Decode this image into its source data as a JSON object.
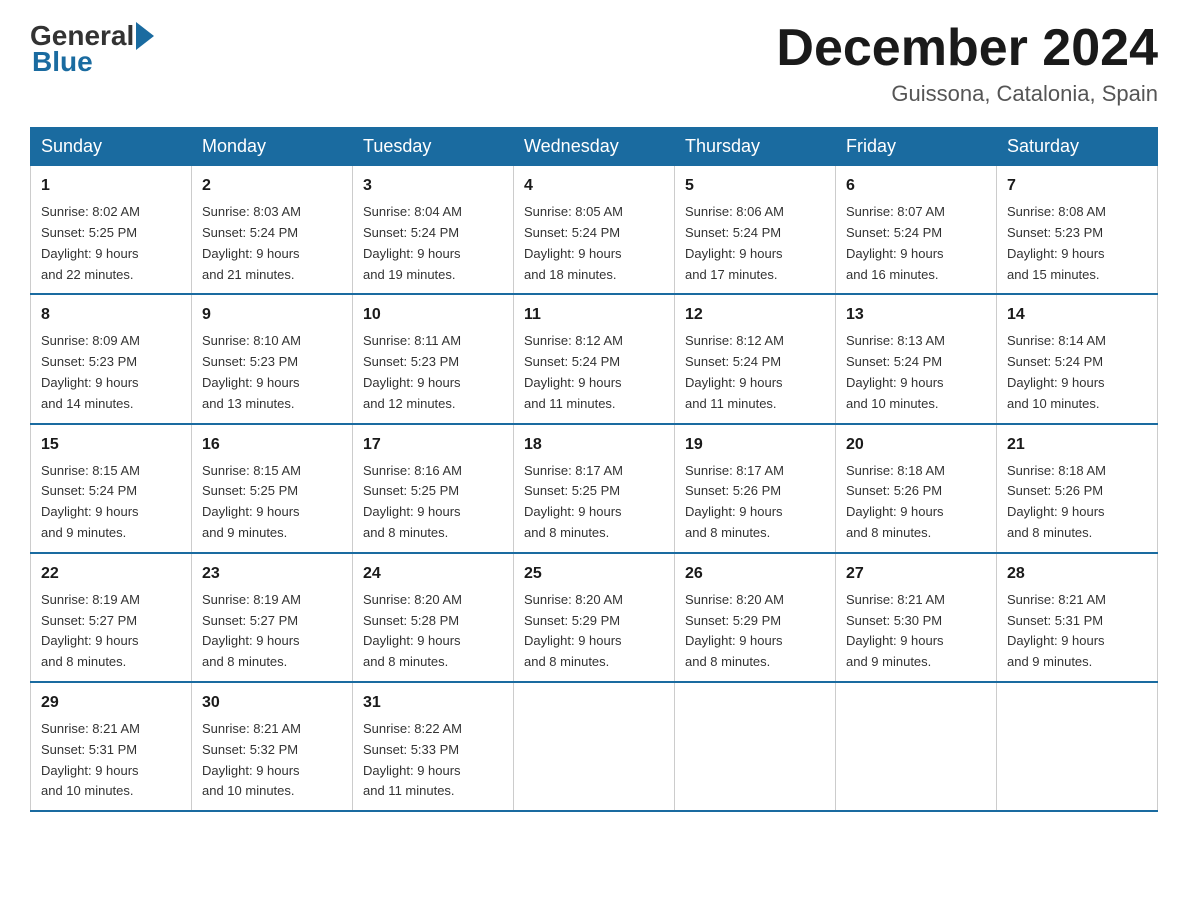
{
  "logo": {
    "general": "General",
    "blue": "Blue"
  },
  "title": "December 2024",
  "location": "Guissona, Catalonia, Spain",
  "headers": [
    "Sunday",
    "Monday",
    "Tuesday",
    "Wednesday",
    "Thursday",
    "Friday",
    "Saturday"
  ],
  "weeks": [
    [
      {
        "day": "1",
        "sunrise": "8:02 AM",
        "sunset": "5:25 PM",
        "daylight": "9 hours and 22 minutes."
      },
      {
        "day": "2",
        "sunrise": "8:03 AM",
        "sunset": "5:24 PM",
        "daylight": "9 hours and 21 minutes."
      },
      {
        "day": "3",
        "sunrise": "8:04 AM",
        "sunset": "5:24 PM",
        "daylight": "9 hours and 19 minutes."
      },
      {
        "day": "4",
        "sunrise": "8:05 AM",
        "sunset": "5:24 PM",
        "daylight": "9 hours and 18 minutes."
      },
      {
        "day": "5",
        "sunrise": "8:06 AM",
        "sunset": "5:24 PM",
        "daylight": "9 hours and 17 minutes."
      },
      {
        "day": "6",
        "sunrise": "8:07 AM",
        "sunset": "5:24 PM",
        "daylight": "9 hours and 16 minutes."
      },
      {
        "day": "7",
        "sunrise": "8:08 AM",
        "sunset": "5:23 PM",
        "daylight": "9 hours and 15 minutes."
      }
    ],
    [
      {
        "day": "8",
        "sunrise": "8:09 AM",
        "sunset": "5:23 PM",
        "daylight": "9 hours and 14 minutes."
      },
      {
        "day": "9",
        "sunrise": "8:10 AM",
        "sunset": "5:23 PM",
        "daylight": "9 hours and 13 minutes."
      },
      {
        "day": "10",
        "sunrise": "8:11 AM",
        "sunset": "5:23 PM",
        "daylight": "9 hours and 12 minutes."
      },
      {
        "day": "11",
        "sunrise": "8:12 AM",
        "sunset": "5:24 PM",
        "daylight": "9 hours and 11 minutes."
      },
      {
        "day": "12",
        "sunrise": "8:12 AM",
        "sunset": "5:24 PM",
        "daylight": "9 hours and 11 minutes."
      },
      {
        "day": "13",
        "sunrise": "8:13 AM",
        "sunset": "5:24 PM",
        "daylight": "9 hours and 10 minutes."
      },
      {
        "day": "14",
        "sunrise": "8:14 AM",
        "sunset": "5:24 PM",
        "daylight": "9 hours and 10 minutes."
      }
    ],
    [
      {
        "day": "15",
        "sunrise": "8:15 AM",
        "sunset": "5:24 PM",
        "daylight": "9 hours and 9 minutes."
      },
      {
        "day": "16",
        "sunrise": "8:15 AM",
        "sunset": "5:25 PM",
        "daylight": "9 hours and 9 minutes."
      },
      {
        "day": "17",
        "sunrise": "8:16 AM",
        "sunset": "5:25 PM",
        "daylight": "9 hours and 8 minutes."
      },
      {
        "day": "18",
        "sunrise": "8:17 AM",
        "sunset": "5:25 PM",
        "daylight": "9 hours and 8 minutes."
      },
      {
        "day": "19",
        "sunrise": "8:17 AM",
        "sunset": "5:26 PM",
        "daylight": "9 hours and 8 minutes."
      },
      {
        "day": "20",
        "sunrise": "8:18 AM",
        "sunset": "5:26 PM",
        "daylight": "9 hours and 8 minutes."
      },
      {
        "day": "21",
        "sunrise": "8:18 AM",
        "sunset": "5:26 PM",
        "daylight": "9 hours and 8 minutes."
      }
    ],
    [
      {
        "day": "22",
        "sunrise": "8:19 AM",
        "sunset": "5:27 PM",
        "daylight": "9 hours and 8 minutes."
      },
      {
        "day": "23",
        "sunrise": "8:19 AM",
        "sunset": "5:27 PM",
        "daylight": "9 hours and 8 minutes."
      },
      {
        "day": "24",
        "sunrise": "8:20 AM",
        "sunset": "5:28 PM",
        "daylight": "9 hours and 8 minutes."
      },
      {
        "day": "25",
        "sunrise": "8:20 AM",
        "sunset": "5:29 PM",
        "daylight": "9 hours and 8 minutes."
      },
      {
        "day": "26",
        "sunrise": "8:20 AM",
        "sunset": "5:29 PM",
        "daylight": "9 hours and 8 minutes."
      },
      {
        "day": "27",
        "sunrise": "8:21 AM",
        "sunset": "5:30 PM",
        "daylight": "9 hours and 9 minutes."
      },
      {
        "day": "28",
        "sunrise": "8:21 AM",
        "sunset": "5:31 PM",
        "daylight": "9 hours and 9 minutes."
      }
    ],
    [
      {
        "day": "29",
        "sunrise": "8:21 AM",
        "sunset": "5:31 PM",
        "daylight": "9 hours and 10 minutes."
      },
      {
        "day": "30",
        "sunrise": "8:21 AM",
        "sunset": "5:32 PM",
        "daylight": "9 hours and 10 minutes."
      },
      {
        "day": "31",
        "sunrise": "8:22 AM",
        "sunset": "5:33 PM",
        "daylight": "9 hours and 11 minutes."
      },
      null,
      null,
      null,
      null
    ]
  ]
}
